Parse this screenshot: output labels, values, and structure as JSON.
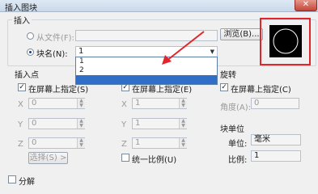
{
  "window": {
    "title": "插入图块",
    "close_glyph": "✕"
  },
  "insert_group": {
    "label": "插入",
    "from_file": {
      "label": "从文件(F):",
      "value": "",
      "browse_label": "浏览(B)...",
      "selected": false
    },
    "block_name": {
      "label": "块名(N):",
      "value": "1",
      "selected": true,
      "options": [
        "1",
        "2",
        ""
      ],
      "highlighted_index": 2
    }
  },
  "insertion_point": {
    "label": "插入点",
    "on_screen_label": "在屏幕上指定(S)",
    "on_screen_checked": true,
    "x": {
      "label": "X",
      "value": "0"
    },
    "y": {
      "label": "Y",
      "value": "0"
    },
    "z": {
      "label": "Z",
      "value": "0"
    },
    "select_label": "选择(S) >"
  },
  "scale": {
    "on_screen_label": "在屏幕上指定(E)",
    "on_screen_checked": true,
    "x": {
      "label": "X",
      "value": "1"
    },
    "y": {
      "label": "Y",
      "value": "1"
    },
    "z": {
      "label": "Z",
      "value": "1"
    },
    "uniform_label": "统一比例(U)",
    "uniform_checked": false
  },
  "rotation": {
    "label": "旋转",
    "on_screen_label": "在屏幕上指定(C)",
    "on_screen_checked": true,
    "angle_label": "角度(A):",
    "angle_value": "0"
  },
  "block_unit": {
    "label": "块单位",
    "unit_label": "单位:",
    "unit_value": "毫米",
    "ratio_label": "比例:",
    "ratio_value": "1"
  },
  "explode": {
    "label": "分解",
    "checked": false
  },
  "annotation": {
    "color": "#e0262a"
  },
  "preview": {
    "background": "#000000"
  },
  "check_glyph": "✓",
  "arrow_glyph": "▼",
  "spin_up": "▲",
  "spin_down": "▼"
}
